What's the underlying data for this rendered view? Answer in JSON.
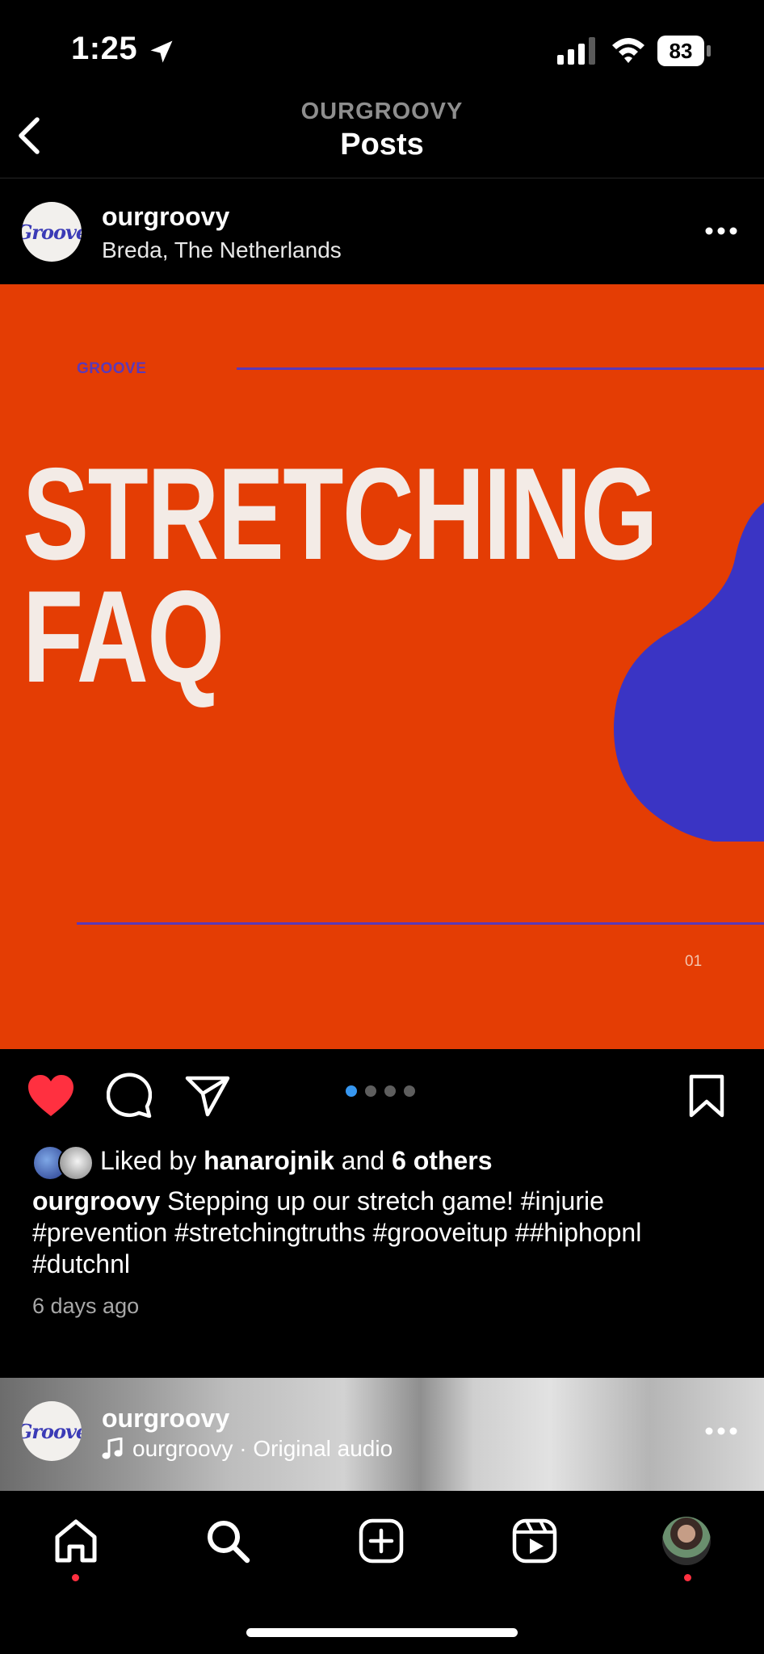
{
  "status_bar": {
    "time": "1:25",
    "battery": "83"
  },
  "header": {
    "subtitle": "OURGROOVY",
    "title": "Posts"
  },
  "post": {
    "avatar_text": "Groove",
    "username": "ourgroovy",
    "location": "Breda, The Netherlands",
    "slide": {
      "brand": "GROOVE",
      "title_line1": "STRETCHING",
      "title_line2": "FAQ",
      "number": "01",
      "colors": {
        "background": "#e43d04",
        "accent": "#3a34c4",
        "text": "#f3ebe6"
      }
    },
    "carousel": {
      "total": 4,
      "active_index": 0
    },
    "liked": true,
    "likes": {
      "prefix": "Liked by",
      "user": "hanarojnik",
      "connector": "and",
      "others": "6 others"
    },
    "caption": {
      "username": "ourgroovy",
      "text": "Stepping up our stretch game! #injurie #prevention #stretchingtruths #grooveitup ##hiphopnl #dutchnl"
    },
    "time_ago": "6 days ago"
  },
  "next_post": {
    "avatar_text": "Groove",
    "username": "ourgroovy",
    "audio": "ourgroovy · Original audio"
  },
  "icons": {
    "back": "chevron-left-icon",
    "more": "more-horizontal-icon",
    "like": "heart-icon",
    "comment": "comment-icon",
    "share": "paper-plane-icon",
    "save": "bookmark-icon",
    "music": "music-note-icon",
    "nav": [
      "home-icon",
      "search-icon",
      "create-icon",
      "reels-icon",
      "profile-avatar"
    ]
  },
  "colors": {
    "like_red": "#ff3040",
    "carousel_active": "#3797f0",
    "secondary_text": "#a8a8a8"
  }
}
